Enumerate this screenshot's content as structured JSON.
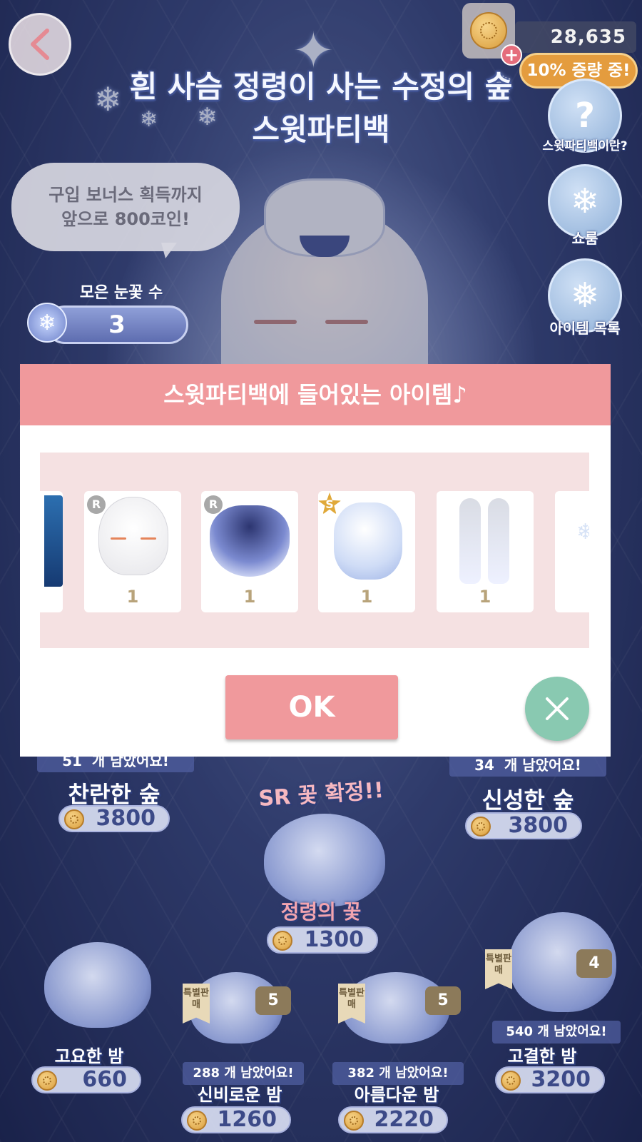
{
  "header": {
    "coin_count": "28,635",
    "bonus_label": "10% 증량 중!",
    "title_line1": "흰 사슴 정령이 사는 수정의 숲",
    "title_line2": "스윗파티백"
  },
  "side_menu": [
    {
      "label": "스윗파티백이란?",
      "icon": "question-icon"
    },
    {
      "label": "쇼룸",
      "icon": "snowflake-icon"
    },
    {
      "label": "아이템 목록",
      "icon": "sparkle-snowflake-icon"
    }
  ],
  "speech_bubble": {
    "line1": "구입 보너스 획득까지",
    "line2": "앞으로 800코인!"
  },
  "snowflake_counter": {
    "label": "모은 눈꽃 수",
    "value": "3"
  },
  "bags": {
    "brilliant_forest": {
      "remaining": "51",
      "remaining_suffix": "개 남았어요!",
      "name": "찬란한 숲",
      "price": "3800"
    },
    "sacred_forest": {
      "remaining": "34",
      "remaining_suffix": "개 남았어요!",
      "name": "신성한 숲",
      "price": "3800"
    },
    "spirit_flower": {
      "badge": "SR 꽃 확정!!",
      "name": "정령의 꽃",
      "price": "1300"
    },
    "quiet_night": {
      "name": "고요한 밤",
      "price": "660"
    },
    "mysterious_night": {
      "special": "특별판매",
      "count": "5",
      "remaining": "288",
      "remaining_suffix": "개 남았어요!",
      "name": "신비로운 밤",
      "price": "1260"
    },
    "beautiful_night": {
      "special": "특별판매",
      "count": "5",
      "remaining": "382",
      "remaining_suffix": "개 남았어요!",
      "name": "아름다운 밤",
      "price": "2220"
    },
    "noble_night": {
      "special": "특별판매",
      "count": "4",
      "remaining": "540",
      "remaining_suffix": "개 남았어요!",
      "name": "고결한 밤",
      "price": "3200"
    }
  },
  "modal": {
    "title": "스윗파티백에 들어있는 아이템♪",
    "items": [
      {
        "rank": "",
        "count": "",
        "icon": "forest-background-icon"
      },
      {
        "rank": "R",
        "count": "1",
        "icon": "face-item-icon"
      },
      {
        "rank": "R",
        "count": "1",
        "icon": "dress-item-icon"
      },
      {
        "rank": "S",
        "count": "1",
        "icon": "snow-pet-item-icon"
      },
      {
        "rank": "",
        "count": "1",
        "icon": "legwear-item-icon"
      },
      {
        "rank": "",
        "count": "",
        "icon": "partial-item-icon"
      }
    ],
    "ok_label": "OK"
  },
  "colors": {
    "modal_header": "#f0999c",
    "strip_bg": "#f5e1e2",
    "close_button": "#89c9b1",
    "count_text": "#b8a37a"
  }
}
